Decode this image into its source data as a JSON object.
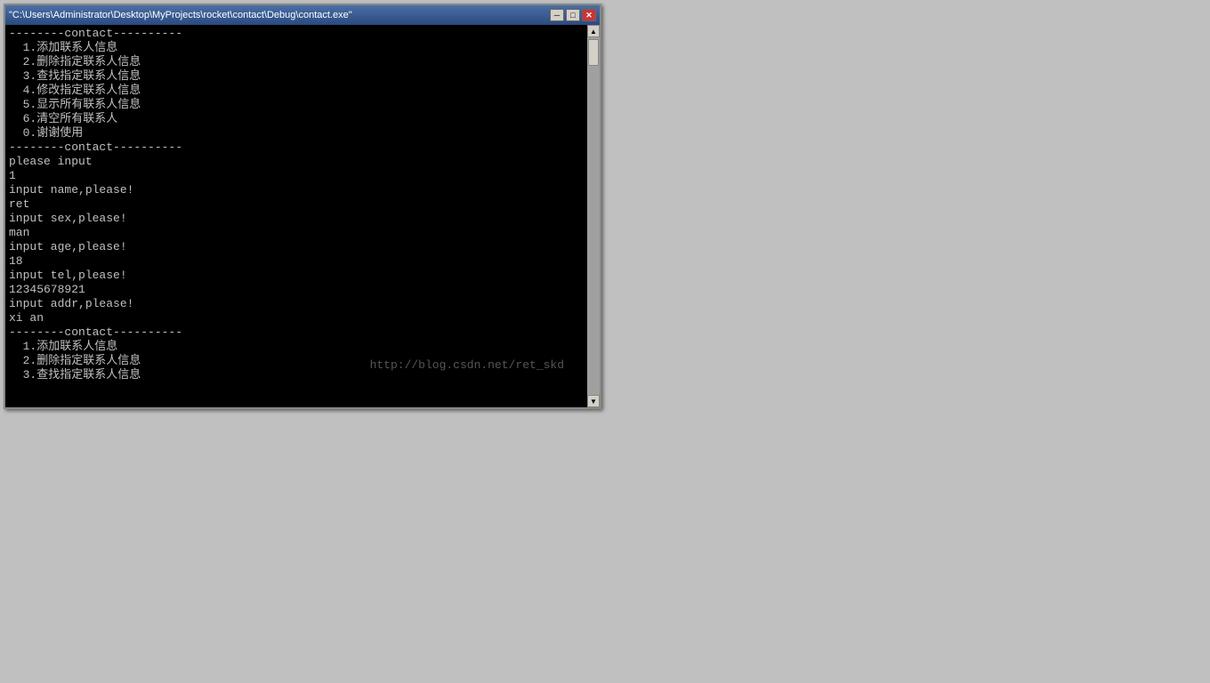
{
  "window": {
    "title": "\"C:\\Users\\Administrator\\Desktop\\MyProjects\\rocket\\contact\\Debug\\contact.exe\"",
    "minimize_label": "─",
    "maximize_label": "□",
    "close_label": "✕"
  },
  "console": {
    "lines": [
      "--------contact----------",
      "  1.添加联系人信息",
      "  2.删除指定联系人信息",
      "  3.查找指定联系人信息",
      "  4.修改指定联系人信息",
      "  5.显示所有联系人信息",
      "  6.清空所有联系人",
      "  0.谢谢使用",
      "--------contact----------",
      "please input",
      "1",
      "input name,please!",
      "ret",
      "input sex,please!",
      "man",
      "input age,please!",
      "18",
      "input tel,please!",
      "12345678921",
      "input addr,please!",
      "xi an",
      "--------contact----------",
      "  1.添加联系人信息",
      "  2.删除指定联系人信息",
      "  3.查找指定联系人信息"
    ],
    "watermark": "http://blog.csdn.net/ret_skd"
  }
}
